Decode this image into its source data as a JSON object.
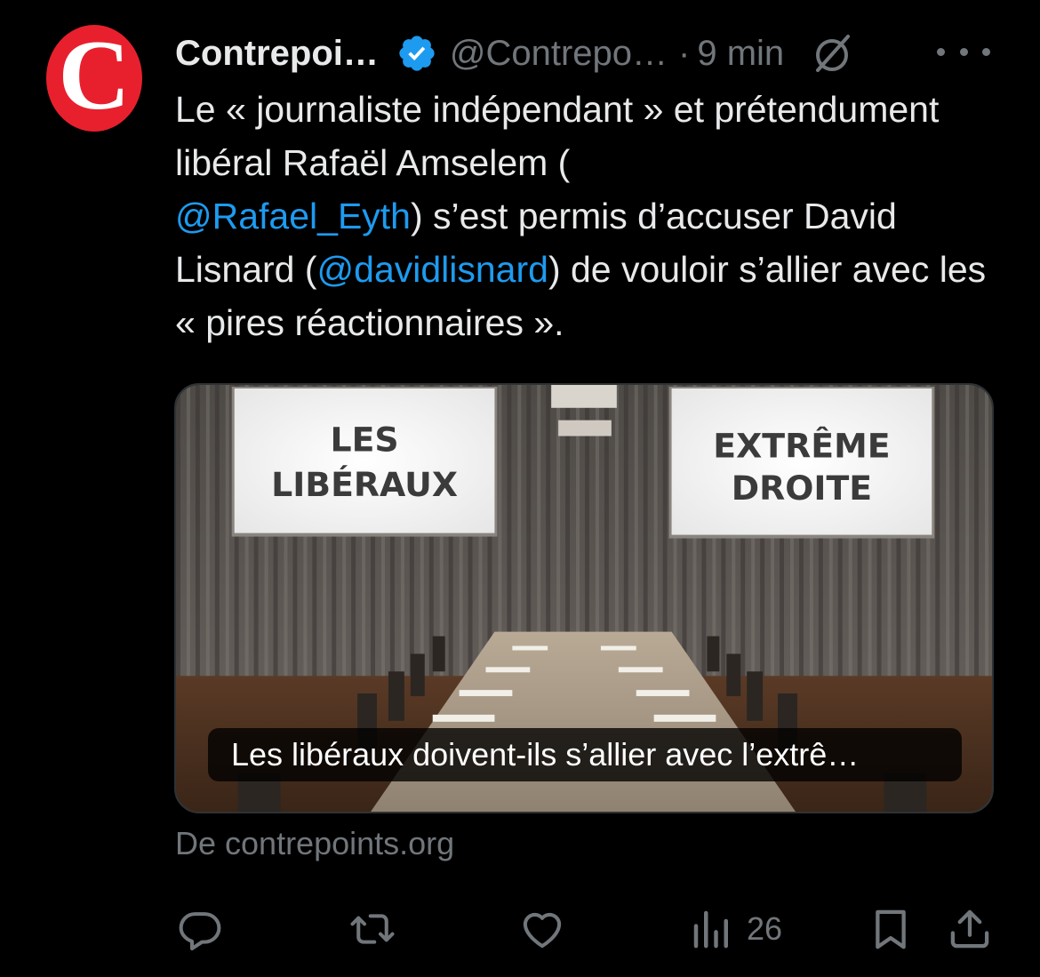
{
  "author": {
    "avatar_letter": "C",
    "display_name": "Contrepoi…",
    "handle": "@Contrepo…",
    "separator": "·",
    "time": "9 min",
    "verified": true
  },
  "tweet": {
    "text_1": "Le « journaliste indépendant » et prétendument libéral Rafaël Amselem (",
    "mention_1": "@Rafael_Eyth",
    "text_2": ") s’est permis d’accuser David Lisnard (",
    "mention_2": "@davidlisnard",
    "text_3": ") de vouloir s’allier avec les « pires réactionnaires »."
  },
  "card": {
    "screen_left_line1": "LES",
    "screen_left_line2": "LIBÉRAUX",
    "screen_right_line1": "EXTRÊME",
    "screen_right_line2": "DROITE",
    "caption": "Les libéraux doivent-ils s’allier avec l’extrê…",
    "source": "De contrepoints.org"
  },
  "actions": {
    "views": "26"
  },
  "colors": {
    "background": "#000000",
    "text": "#e7e9ea",
    "secondary": "#71767b",
    "link": "#1d9bf0",
    "verified": "#1d9bf0",
    "avatar": "#e8202e"
  },
  "icons": [
    "verified-badge-icon",
    "grok-icon",
    "more-icon",
    "reply-icon",
    "repost-icon",
    "like-icon",
    "views-icon",
    "bookmark-icon",
    "share-icon"
  ]
}
